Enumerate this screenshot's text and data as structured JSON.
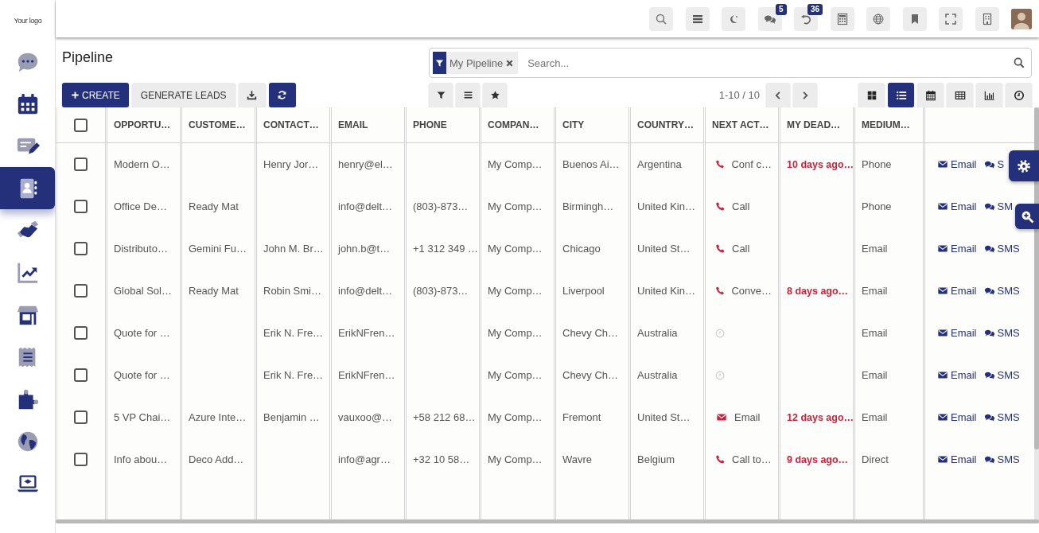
{
  "sidebar": {
    "logo": "Your logo",
    "items": [
      {
        "selected": false
      },
      {
        "selected": false
      },
      {
        "selected": false
      },
      {
        "selected": true
      },
      {
        "selected": false
      },
      {
        "selected": false
      },
      {
        "selected": false
      },
      {
        "selected": false
      },
      {
        "selected": false
      },
      {
        "selected": false
      },
      {
        "selected": false
      }
    ]
  },
  "topbar": {
    "chat_badge": "5",
    "activity_badge": "36"
  },
  "page": {
    "title": "Pipeline",
    "facet": "My Pipeline",
    "search_placeholder": "Search...",
    "create": "CREATE",
    "generate": "GENERATE LEADS",
    "pager": "1-10 / 10",
    "views": [
      {
        "selected": false
      },
      {
        "selected": true
      },
      {
        "selected": false
      },
      {
        "selected": false
      },
      {
        "selected": false
      },
      {
        "selected": false
      }
    ]
  },
  "table": {
    "all_checked": false,
    "columns": [
      "OPPORTU…",
      "CUSTOME…",
      "CONTACT…",
      "EMAIL",
      "PHONE",
      "COMPAN…",
      "CITY",
      "COUNTRY…",
      "NEXT ACT…",
      "MY DEAD…",
      "MEDIUM…"
    ],
    "rows": [
      {
        "checked": false,
        "opportunity": "Modern O…",
        "contact": "Henry Jor…",
        "email": "henry@el…",
        "company": "My Comp…",
        "city": "Buenos Ai…",
        "country": "Argentina",
        "next_activity": {
          "kind": "phone",
          "text": "Conf c…"
        },
        "deadline": "10 days ago…",
        "medium": "Phone",
        "email_link": "Email",
        "sms_link": "S"
      },
      {
        "checked": false,
        "opportunity": "Office De…",
        "customer": "Ready Mat",
        "email": "info@delt…",
        "phone": "(803)-873…",
        "company": "My Comp…",
        "city": "Birmingh…",
        "country": "United Kin…",
        "next_activity": {
          "kind": "phone",
          "text": "Call"
        },
        "medium": "Phone",
        "email_link": "Email",
        "sms_link": "SM"
      },
      {
        "checked": false,
        "opportunity": "Distributo…",
        "customer": "Gemini Fu…",
        "contact": "John M. Br…",
        "email": "john.b@t…",
        "phone": "+1 312 349 …",
        "company": "My Comp…",
        "city": "Chicago",
        "country": "United St…",
        "next_activity": {
          "kind": "phone",
          "text": "Call"
        },
        "medium": "Email",
        "email_link": "Email",
        "sms_link": "SMS"
      },
      {
        "checked": false,
        "opportunity": "Global Sol…",
        "customer": "Ready Mat",
        "contact": "Robin Smi…",
        "email": "info@delt…",
        "phone": "(803)-873…",
        "company": "My Comp…",
        "city": "Liverpool",
        "country": "United Kin…",
        "next_activity": {
          "kind": "phone",
          "text": "Conve…"
        },
        "deadline": "8 days ago…",
        "medium": "Email",
        "email_link": "Email",
        "sms_link": "SMS"
      },
      {
        "checked": false,
        "opportunity": "Quote for …",
        "contact": "Erik N. Fre…",
        "email": "ErikNFren…",
        "company": "My Comp…",
        "city": "Chevy Ch…",
        "country": "Australia",
        "next_activity": {
          "kind": "none"
        },
        "medium": "Email",
        "email_link": "Email",
        "sms_link": "SMS"
      },
      {
        "checked": false,
        "opportunity": "Quote for …",
        "contact": "Erik N. Fre…",
        "email": "ErikNFren…",
        "company": "My Comp…",
        "city": "Chevy Ch…",
        "country": "Australia",
        "next_activity": {
          "kind": "none"
        },
        "medium": "Email",
        "email_link": "Email",
        "sms_link": "SMS"
      },
      {
        "checked": false,
        "opportunity": "5 VP Chai…",
        "customer": "Azure Inte…",
        "contact": "Benjamin …",
        "email": "vauxoo@…",
        "phone": "+58 212 68…",
        "company": "My Comp…",
        "city": "Fremont",
        "country": "United St…",
        "next_activity": {
          "kind": "email",
          "text": "Email"
        },
        "deadline": "12 days ago…",
        "medium": "Email",
        "email_link": "Email",
        "sms_link": "SMS"
      },
      {
        "checked": false,
        "opportunity": "Info abou…",
        "customer": "Deco Add…",
        "email": "info@agr…",
        "phone": "+32 10 58…",
        "company": "My Comp…",
        "city": "Wavre",
        "country": "Belgium",
        "next_activity": {
          "kind": "phone",
          "text": "Call to…"
        },
        "deadline": "9 days ago…",
        "medium": "Direct",
        "email_link": "Email",
        "sms_link": "SMS"
      }
    ]
  }
}
